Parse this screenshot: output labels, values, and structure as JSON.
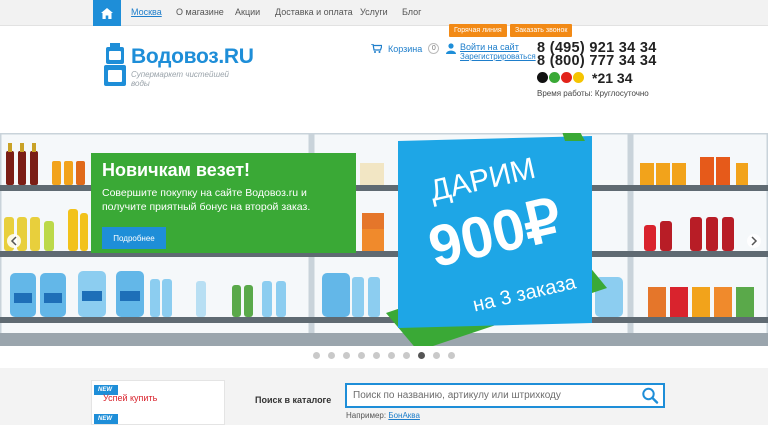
{
  "nav": {
    "home_icon": "home-icon",
    "city": "Москва",
    "items": [
      "О магазине",
      "Акции",
      "Доставка и оплата",
      "Услуги",
      "Блог"
    ]
  },
  "header": {
    "logo_text": "Водовоз.RU",
    "tagline": "Супермаркет чистейшей воды",
    "cart_label": "Корзина",
    "cart_count": "0",
    "login_label": "Войти на сайт",
    "register_label": "Зарегистрироваться",
    "hotline_label": "Горячая линия",
    "callback_label": "Заказать звонок",
    "phone1": "8 (495) 921 34 34",
    "phone2": "8 (800) 777 34 34",
    "short_number": "*21 34",
    "hours": "Время работы: Круглосуточно"
  },
  "banner": {
    "title": "Новичкам везет!",
    "text": "Совершите покупку на сайте Водовоз.ru и получите приятный бонус на второй заказ.",
    "button_label": "Подробнее",
    "offer_top": "ДАРИМ",
    "offer_amount": "900₽",
    "offer_bottom": "на 3 заказа",
    "slide_count": 10,
    "active_slide": 8
  },
  "sidebar": {
    "new_tag": "NEW",
    "link": "Успей купить"
  },
  "search": {
    "label": "Поиск в каталоге",
    "placeholder": "Поиск по названию, артикулу или штрихкоду",
    "example_prefix": "Например:",
    "example_link": "БонАква"
  },
  "colors": {
    "accent_blue": "#1e8ed8",
    "promo_green": "#3aa936",
    "orange": "#f28a16",
    "sale_red": "#d9232d"
  }
}
